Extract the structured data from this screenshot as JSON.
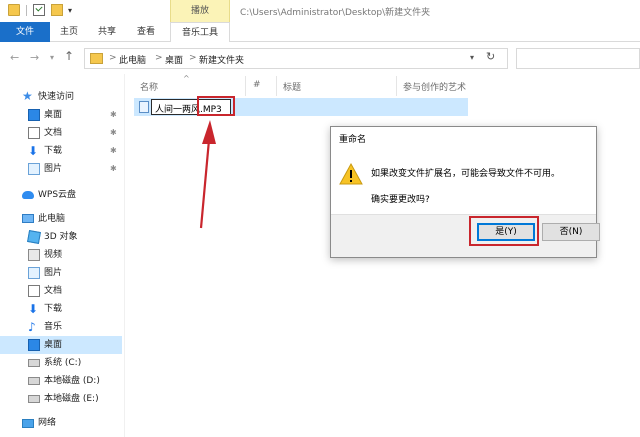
{
  "titlebar": {
    "context_tab": "播放",
    "window_path": "C:\\Users\\Administrator\\Desktop\\新建文件夹"
  },
  "ribbon": {
    "tabs": [
      "文件",
      "主页",
      "共享",
      "查看",
      "音乐工具"
    ]
  },
  "address": {
    "crumbs": [
      "此电脑",
      "桌面",
      "新建文件夹"
    ],
    "separator": ">"
  },
  "sidebar": {
    "items": [
      {
        "label": "快速访问",
        "icon": "star-icon"
      },
      {
        "label": "桌面",
        "icon": "desktop-icon",
        "pinned": true
      },
      {
        "label": "文档",
        "icon": "document-icon",
        "pinned": true
      },
      {
        "label": "下载",
        "icon": "download-icon",
        "pinned": true
      },
      {
        "label": "图片",
        "icon": "pictures-icon",
        "pinned": true
      },
      {
        "label": "WPS云盘",
        "icon": "cloud-icon"
      },
      {
        "label": "此电脑",
        "icon": "pc-icon"
      },
      {
        "label": "3D 对象",
        "icon": "3d-objects-icon"
      },
      {
        "label": "视频",
        "icon": "video-icon"
      },
      {
        "label": "图片",
        "icon": "pictures-icon"
      },
      {
        "label": "文档",
        "icon": "document-icon"
      },
      {
        "label": "下载",
        "icon": "download-icon"
      },
      {
        "label": "音乐",
        "icon": "music-icon"
      },
      {
        "label": "桌面",
        "icon": "desktop-icon",
        "selected": true
      },
      {
        "label": "系统 (C:)",
        "icon": "drive-icon"
      },
      {
        "label": "本地磁盘 (D:)",
        "icon": "drive-icon"
      },
      {
        "label": "本地磁盘 (E:)",
        "icon": "drive-icon"
      },
      {
        "label": "网络",
        "icon": "network-icon"
      }
    ]
  },
  "columns": {
    "name": "名称",
    "number": "#",
    "title": "标题",
    "artist": "参与创作的艺术"
  },
  "file": {
    "rename_value": "人间一两风.MP3"
  },
  "dialog": {
    "title": "重命名",
    "message": "如果改变文件扩展名，可能会导致文件不可用。",
    "question": "确实要更改吗?",
    "yes_label": "是(Y)",
    "no_label": "否(N)"
  },
  "colors": {
    "accent": "#1a6fc9",
    "selection": "#cce8ff",
    "annotation_red": "#c9262d"
  }
}
